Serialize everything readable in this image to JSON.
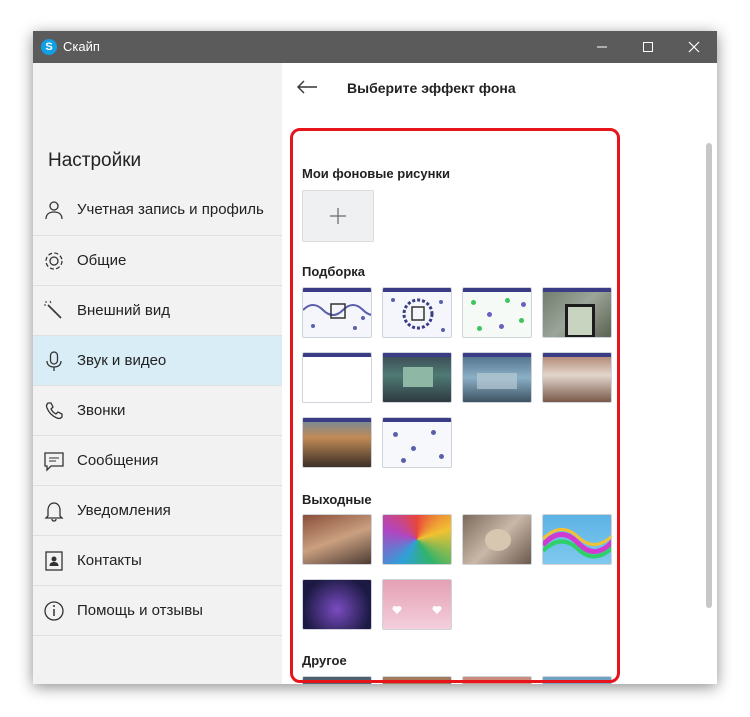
{
  "window": {
    "title": "Скайп",
    "logo_letter": "S"
  },
  "sidebar": {
    "title": "Настройки",
    "items": [
      {
        "label": "Учетная запись и профиль",
        "icon": "person-icon"
      },
      {
        "label": "Общие",
        "icon": "gear-icon"
      },
      {
        "label": "Внешний вид",
        "icon": "magic-wand-icon"
      },
      {
        "label": "Звук и видео",
        "icon": "microphone-icon",
        "active": true
      },
      {
        "label": "Звонки",
        "icon": "phone-icon"
      },
      {
        "label": "Сообщения",
        "icon": "message-icon"
      },
      {
        "label": "Уведомления",
        "icon": "bell-icon"
      },
      {
        "label": "Контакты",
        "icon": "contact-card-icon"
      },
      {
        "label": "Помощь и отзывы",
        "icon": "info-icon"
      }
    ]
  },
  "content": {
    "title": "Выберите эффект фона",
    "sections": {
      "my_backgrounds": "Мои фоновые рисунки",
      "featured": "Подборка",
      "weekend": "Выходные",
      "other": "Другое"
    }
  },
  "colors": {
    "accent": "#0fa0e6",
    "active_item": "#d9edf7",
    "highlight": "#e8141c",
    "titlebar": "#5b5b5b"
  }
}
